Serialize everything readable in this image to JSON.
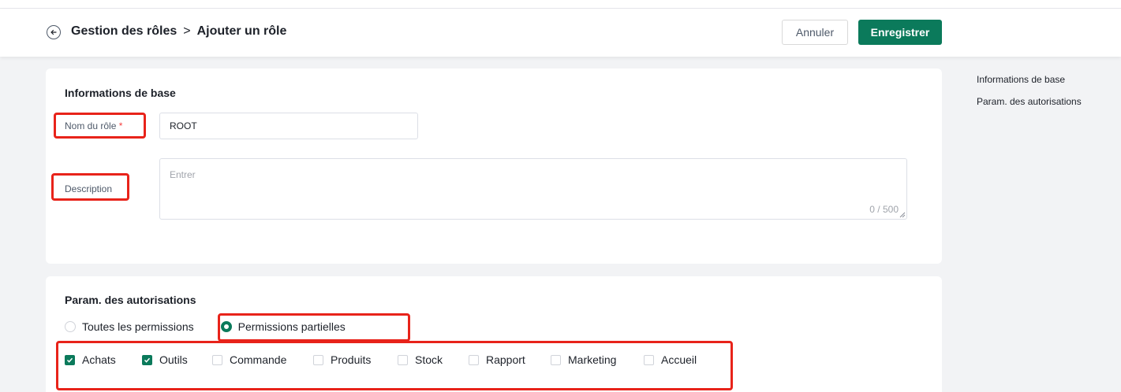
{
  "header": {
    "breadcrumb_parent": "Gestion des rôles",
    "breadcrumb_separator": ">",
    "breadcrumb_current": "Ajouter un rôle",
    "cancel_label": "Annuler",
    "save_label": "Enregistrer",
    "back_icon": "arrow-left-icon"
  },
  "base_info": {
    "title": "Informations de base",
    "role_name_label": "Nom du rôle",
    "required_mark": "*",
    "role_name_value": "ROOT",
    "description_label": "Description",
    "description_placeholder": "Entrer",
    "description_counter": "0 / 500"
  },
  "permissions": {
    "title": "Param. des autorisations",
    "radio_options": [
      {
        "label": "Toutes les permissions",
        "selected": false
      },
      {
        "label": "Permissions partielles",
        "selected": true
      }
    ],
    "modules": [
      {
        "label": "Achats",
        "checked": true
      },
      {
        "label": "Outils",
        "checked": true
      },
      {
        "label": "Commande",
        "checked": false
      },
      {
        "label": "Produits",
        "checked": false
      },
      {
        "label": "Stock",
        "checked": false
      },
      {
        "label": "Rapport",
        "checked": false
      },
      {
        "label": "Marketing",
        "checked": false
      },
      {
        "label": "Accueil",
        "checked": false
      }
    ]
  },
  "anchor_nav": {
    "items": [
      "Informations de base",
      "Param. des autorisations"
    ]
  },
  "colors": {
    "primary": "#0b7a5b",
    "highlight": "#e8231a",
    "required": "#f53f3f"
  }
}
